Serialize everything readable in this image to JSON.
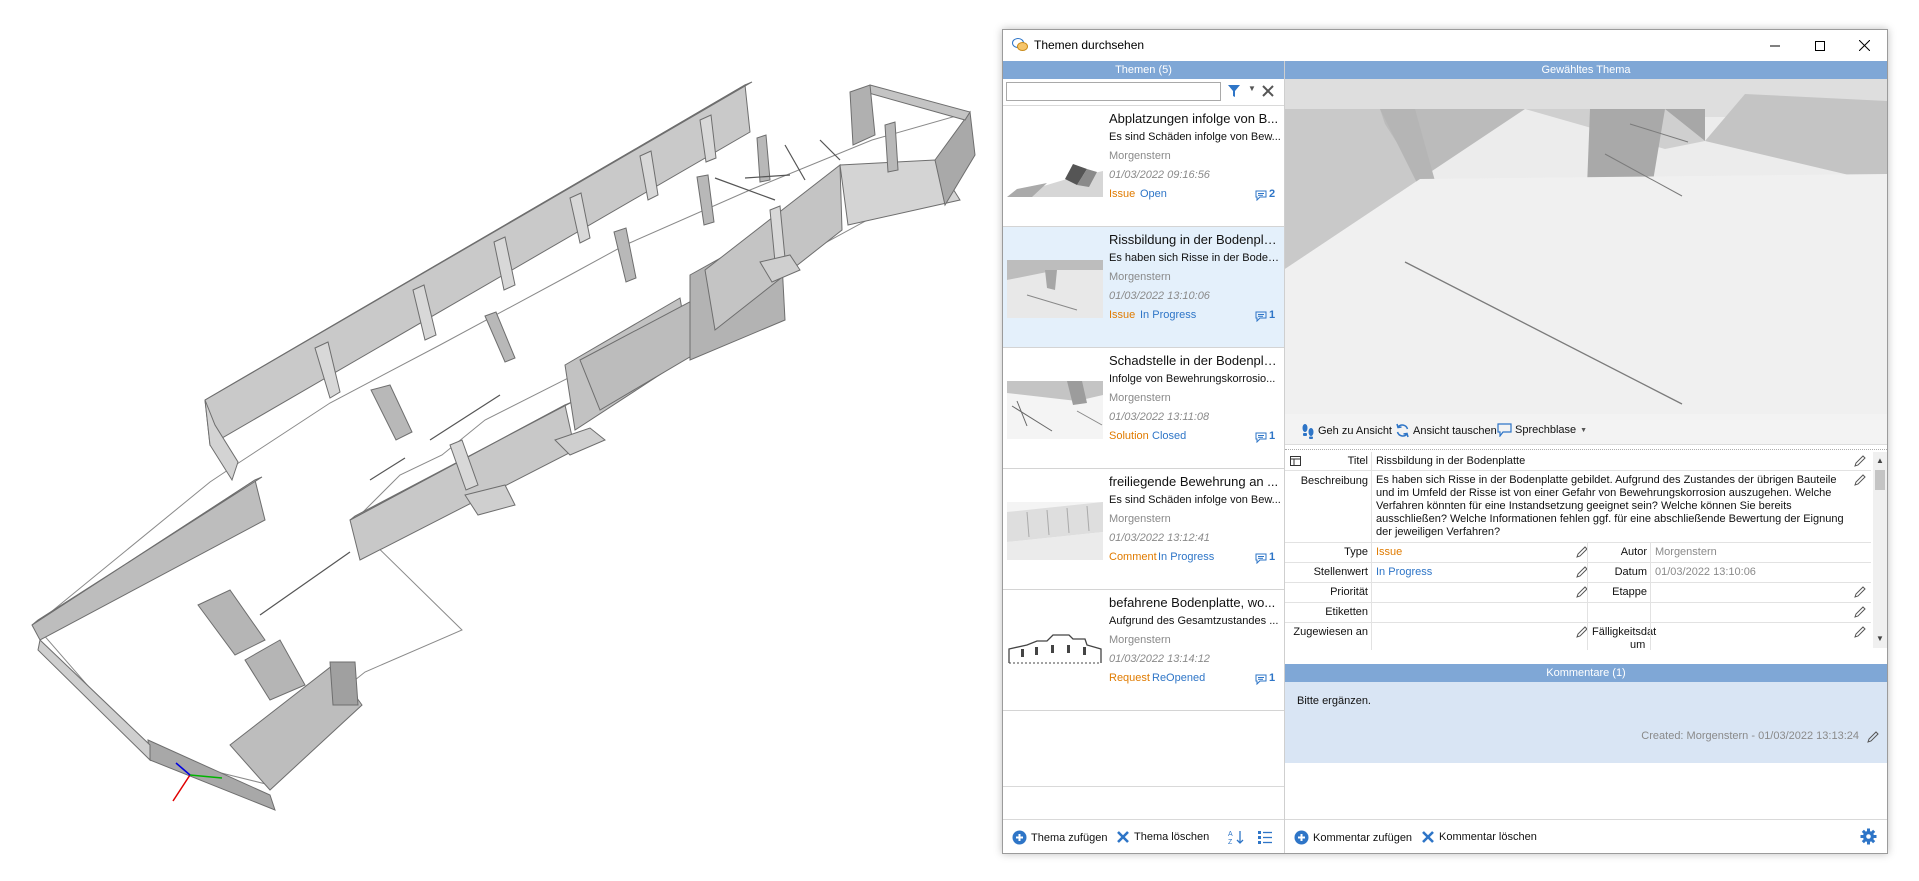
{
  "window": {
    "title": "Themen durchsehen",
    "minimize_glyph": "minimize-icon",
    "maximize_glyph": "maximize-icon",
    "close_glyph": "close-icon"
  },
  "left_pane": {
    "header": "Themen (5)",
    "filter_value": "",
    "topics": [
      {
        "title": "Abplatzungen infolge von B...",
        "description": "Es sind Schäden infolge von Bew...",
        "author": "Morgenstern",
        "date": "01/03/2022 09:16:56",
        "type": "Issue",
        "status": "Open",
        "comments": "2",
        "selected": false
      },
      {
        "title": "Rissbildung in der Bodenpla...",
        "description": "Es haben sich Risse in der Boden...",
        "author": "Morgenstern",
        "date": "01/03/2022 13:10:06",
        "type": "Issue",
        "status": "In Progress",
        "comments": "1",
        "selected": true
      },
      {
        "title": "Schadstelle in der Bodenpla...",
        "description": "Infolge von Bewehrungskorrosio...",
        "author": "Morgenstern",
        "date": "01/03/2022 13:11:08",
        "type": "Solution",
        "status": "Closed",
        "comments": "1",
        "selected": false
      },
      {
        "title": "freiliegende Bewehrung an ...",
        "description": "Es sind Schäden infolge von Bew...",
        "author": "Morgenstern",
        "date": "01/03/2022 13:12:41",
        "type": "Comment",
        "status": "In Progress",
        "comments": "1",
        "selected": false
      },
      {
        "title": "befahrene Bodenplatte, wo...",
        "description": "Aufgrund des Gesamtzustandes ...",
        "author": "Morgenstern",
        "date": "01/03/2022 13:14:12",
        "type": "Request",
        "status": "ReOpened",
        "comments": "1",
        "selected": false
      }
    ],
    "toolbar": {
      "add_label": "Thema zufügen",
      "delete_label": "Thema löschen"
    }
  },
  "right_pane": {
    "header": "Gewähltes Thema",
    "view_toolbar": {
      "goto_label": "Geh zu Ansicht",
      "swap_label": "Ansicht tauschen",
      "bubble_label": "Sprechblase"
    },
    "properties": {
      "title_label": "Titel",
      "title_value": "Rissbildung in der Bodenplatte",
      "description_label": "Beschreibung",
      "description_value": "Es haben sich Risse in der Bodenplatte gebildet. Aufgrund des Zustandes der übrigen Bauteile und im Umfeld der Risse ist von einer Gefahr von Bewehrungskorrosion auszugehen. Welche Verfahren könnten für eine Instandsetzung geeignet sein? Welche können Sie bereits ausschließen? Welche Informationen fehlen ggf. für eine abschließende Bewertung der Eignung der jeweiligen Verfahren?",
      "type_label": "Type",
      "type_value": "Issue",
      "author_label": "Autor",
      "author_value": "Morgenstern",
      "status_label": "Stellenwert",
      "status_value": "In Progress",
      "date_label": "Datum",
      "date_value": "01/03/2022 13:10:06",
      "priority_label": "Priorität",
      "priority_value": "",
      "stage_label": "Etappe",
      "stage_value": "",
      "labels_label": "Etiketten",
      "labels_value": "",
      "assigned_label": "Zugewiesen an",
      "assigned_value": "",
      "due_label_line1": "Fälligkeitsdat",
      "due_label_line2": "um",
      "due_value": ""
    },
    "comments_header": "Kommentare (1)",
    "comments": [
      {
        "text": "Bitte ergänzen.",
        "meta": "Created: Morgenstern - 01/03/2022 13:13:24"
      }
    ],
    "toolbar": {
      "add_label": "Kommentar zufügen",
      "delete_label": "Kommentar löschen"
    }
  },
  "colors": {
    "header_blue": "#7fa7d6",
    "type_orange": "#e07b00",
    "status_blue": "#2e75c7",
    "selected_row": "#e4f0fb",
    "comment_bg": "#d9e5f4"
  }
}
